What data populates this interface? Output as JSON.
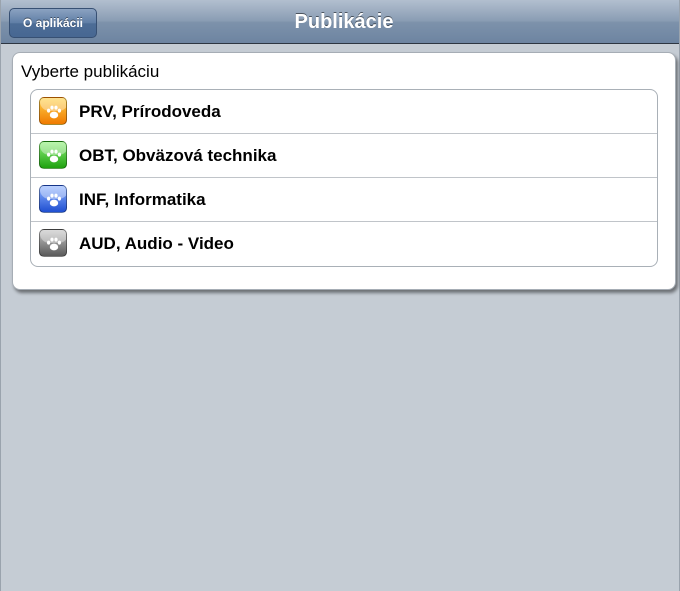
{
  "navbar": {
    "back_label": "O aplikácii",
    "title": "Publikácie"
  },
  "panel": {
    "heading": "Vyberte publikáciu"
  },
  "publications": [
    {
      "label": "PRV, Prírodoveda",
      "icon": "paw-icon",
      "color_top": "#ffd24a",
      "color_bottom": "#f07a00"
    },
    {
      "label": "OBT, Obväzová technika",
      "icon": "paw-icon",
      "color_top": "#8ff07a",
      "color_bottom": "#1fa10f"
    },
    {
      "label": "INF, Informatika",
      "icon": "paw-icon",
      "color_top": "#8fb3ff",
      "color_bottom": "#1f4fd1"
    },
    {
      "label": "AUD, Audio - Video",
      "icon": "paw-icon",
      "color_top": "#c4c4c4",
      "color_bottom": "#5a5a5a"
    }
  ]
}
